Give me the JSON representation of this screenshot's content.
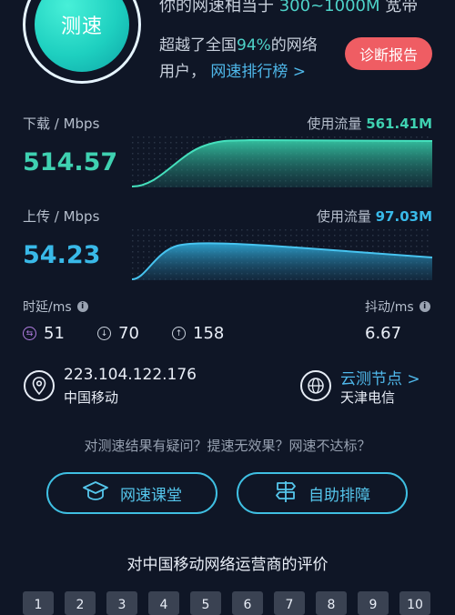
{
  "summary": {
    "speed_button_label": "测速",
    "top_line_prefix": "你的网速相当于",
    "top_line_range": "300~1000M",
    "top_line_suffix": "宽带",
    "beat_prefix": "超越了全国",
    "beat_percent": "94%",
    "beat_suffix": "的网络",
    "users_label": "用户，",
    "ranking_link": "网速排行榜 >",
    "diagnose_button": "诊断报告"
  },
  "download": {
    "label": "下载 / Mbps",
    "value": "514.57",
    "traffic_label": "使用流量",
    "traffic_value": "561.41M"
  },
  "upload": {
    "label": "上传 / Mbps",
    "value": "54.23",
    "traffic_label": "使用流量",
    "traffic_value": "97.03M"
  },
  "latency": {
    "label": "时延/ms",
    "items": [
      {
        "icon": "swap-arrows-icon",
        "value": "51",
        "color": "#b07de0"
      },
      {
        "icon": "arrow-down-circle-icon",
        "value": "70",
        "color": "#c9d1dc"
      },
      {
        "icon": "arrow-up-circle-icon",
        "value": "158",
        "color": "#c9d1dc"
      }
    ],
    "jitter_label": "抖动/ms",
    "jitter_value": "6.67"
  },
  "network": {
    "ip": "223.104.122.176",
    "isp": "中国移动",
    "node_link": "云测节点 >",
    "node_name": "天津电信"
  },
  "question": "对测速结果有疑问？提速无效果？网速不达标？",
  "buttons": {
    "classroom": "网速课堂",
    "troubleshoot": "自助排障"
  },
  "rating": {
    "title": "对中国移动网络运营商的评价",
    "scores": [
      "1",
      "2",
      "3",
      "4",
      "5",
      "6",
      "7",
      "8",
      "9",
      "10"
    ]
  },
  "colors": {
    "background": "#0f1626",
    "download": "#3fd1b1",
    "upload": "#39b9e8",
    "diagnose": "#ef5d63"
  }
}
